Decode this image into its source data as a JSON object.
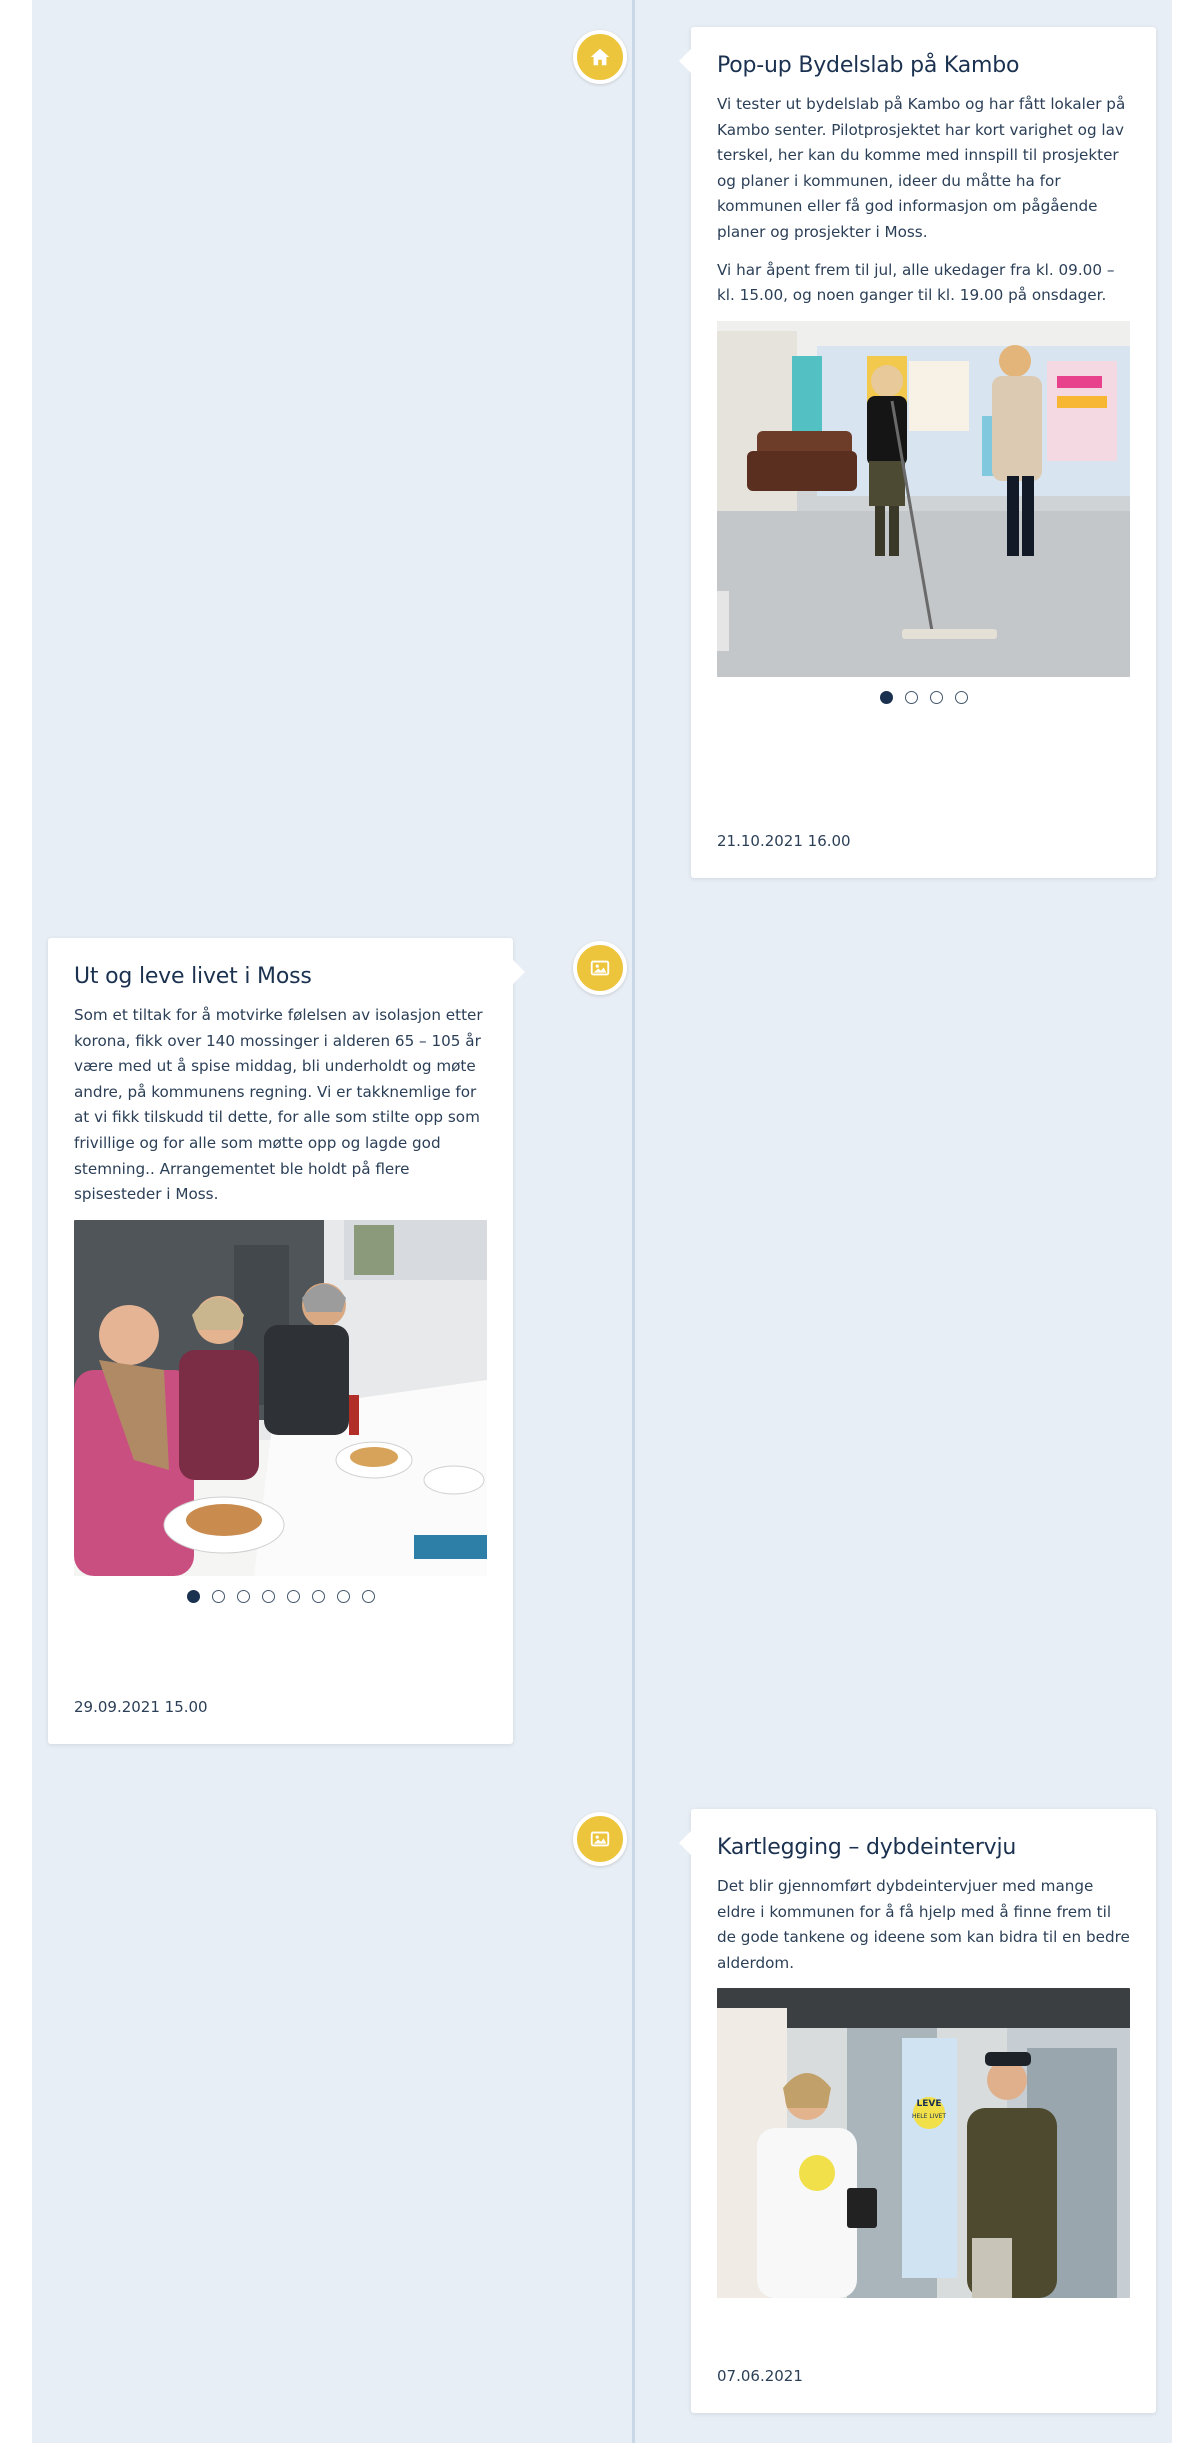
{
  "timeline": {
    "entries": [
      {
        "icon": "home-icon",
        "title": "Pop-up Bydelslab på Kambo",
        "paragraphs": [
          "Vi tester ut bydelslab på Kambo og har fått lokaler på Kambo senter. Pilotprosjektet har kort varighet og lav terskel, her kan du komme med innspill til prosjekter og planer i kommunen, ideer du måtte ha for kommunen eller få god informasjon om pågående planer og prosjekter i Moss.",
          "Vi har åpent frem til jul, alle ukedager fra kl. 09.00 – kl. 15.00, og noen ganger til kl. 19.00 på onsdager."
        ],
        "image_count": 4,
        "active_image": 1,
        "date": "21.10.2021 16.00"
      },
      {
        "icon": "image-icon",
        "title": "Ut og leve livet i Moss",
        "paragraphs": [
          "Som et tiltak for å motvirke følelsen av isolasjon etter korona, fikk over 140 mossinger i alderen 65 – 105 år være med ut å spise middag, bli underholdt og møte andre, på kommunens regning. Vi er takknemlige for at vi fikk tilskudd til dette, for alle som stilte opp som frivillige og for alle som møtte opp og lagde god stemning.. Arrangementet ble holdt på flere spisesteder i Moss."
        ],
        "image_count": 8,
        "active_image": 1,
        "date": "29.09.2021 15.00"
      },
      {
        "icon": "image-icon",
        "title": "Kartlegging – dybdeintervju",
        "paragraphs": [
          "Det blir gjennomført dybdeintervjuer med mange eldre i kommunen for å få hjelp med å finne frem til de gode tankene og ideene som kan bidra til en bedre alderdom."
        ],
        "image_count": 1,
        "active_image": 1,
        "date": "07.06.2021"
      }
    ]
  },
  "photo3": {
    "banner_text": "LEVE HELE LIVET"
  },
  "colors": {
    "background": "#e8eef5",
    "line": "#c9d8e6",
    "marker": "#ecc53c",
    "title": "#1b3150",
    "dot_active": "#1b3150"
  }
}
